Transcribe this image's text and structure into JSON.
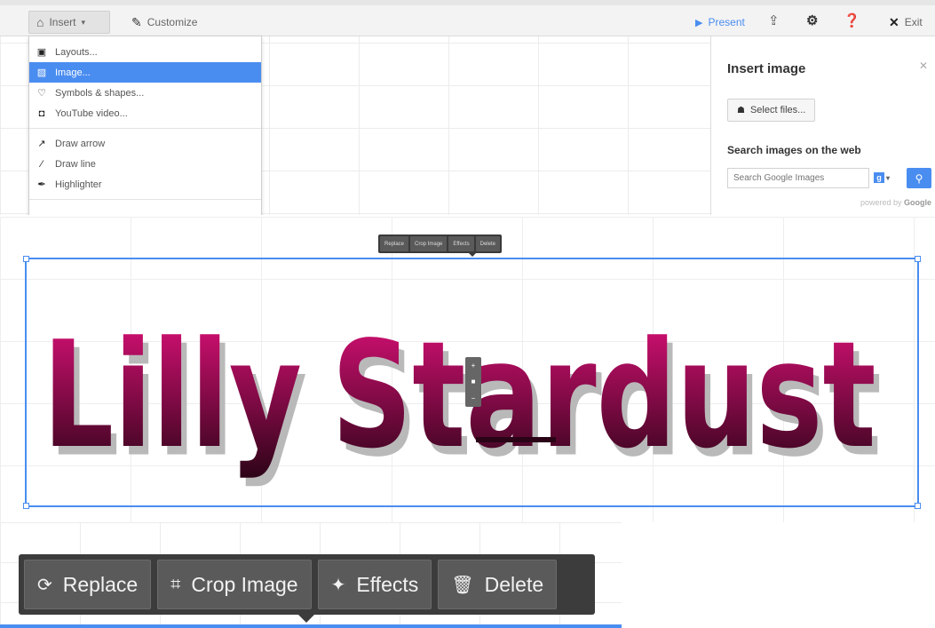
{
  "toolbar": {
    "insert_label": "Insert",
    "customize_label": "Customize",
    "present_label": "Present",
    "exit_label": "Exit"
  },
  "insert_menu": {
    "items": [
      {
        "label": "Layouts...",
        "icon": "layout-icon"
      },
      {
        "label": "Image...",
        "icon": "image-icon",
        "active": true
      },
      {
        "label": "Symbols & shapes...",
        "icon": "shapes-icon"
      },
      {
        "label": "YouTube video...",
        "icon": "video-icon"
      },
      {
        "label": "Draw arrow",
        "icon": "arrow-icon"
      },
      {
        "label": "Draw line",
        "icon": "line-icon"
      },
      {
        "label": "Highlighter",
        "icon": "highlighter-icon"
      }
    ]
  },
  "insert_panel": {
    "title": "Insert image",
    "select_files_label": "Select files...",
    "search_title": "Search images on the web",
    "search_placeholder": "Search Google Images",
    "powered_by": "powered by",
    "powered_brand": "Google"
  },
  "slide": {
    "title_text_part1": "Lilly",
    "title_text_part2": "Stardust",
    "gradient_top": "#e0117a",
    "gradient_bottom": "#2a0416",
    "mini_toolbar": [
      "Replace",
      "Crop Image",
      "Effects",
      "Delete"
    ]
  },
  "image_toolbar": {
    "replace_label": "Replace",
    "crop_label": "Crop Image",
    "effects_label": "Effects",
    "delete_label": "Delete"
  },
  "colors": {
    "accent": "#4a8df0",
    "toolbar_bg": "#3c3c3c"
  }
}
